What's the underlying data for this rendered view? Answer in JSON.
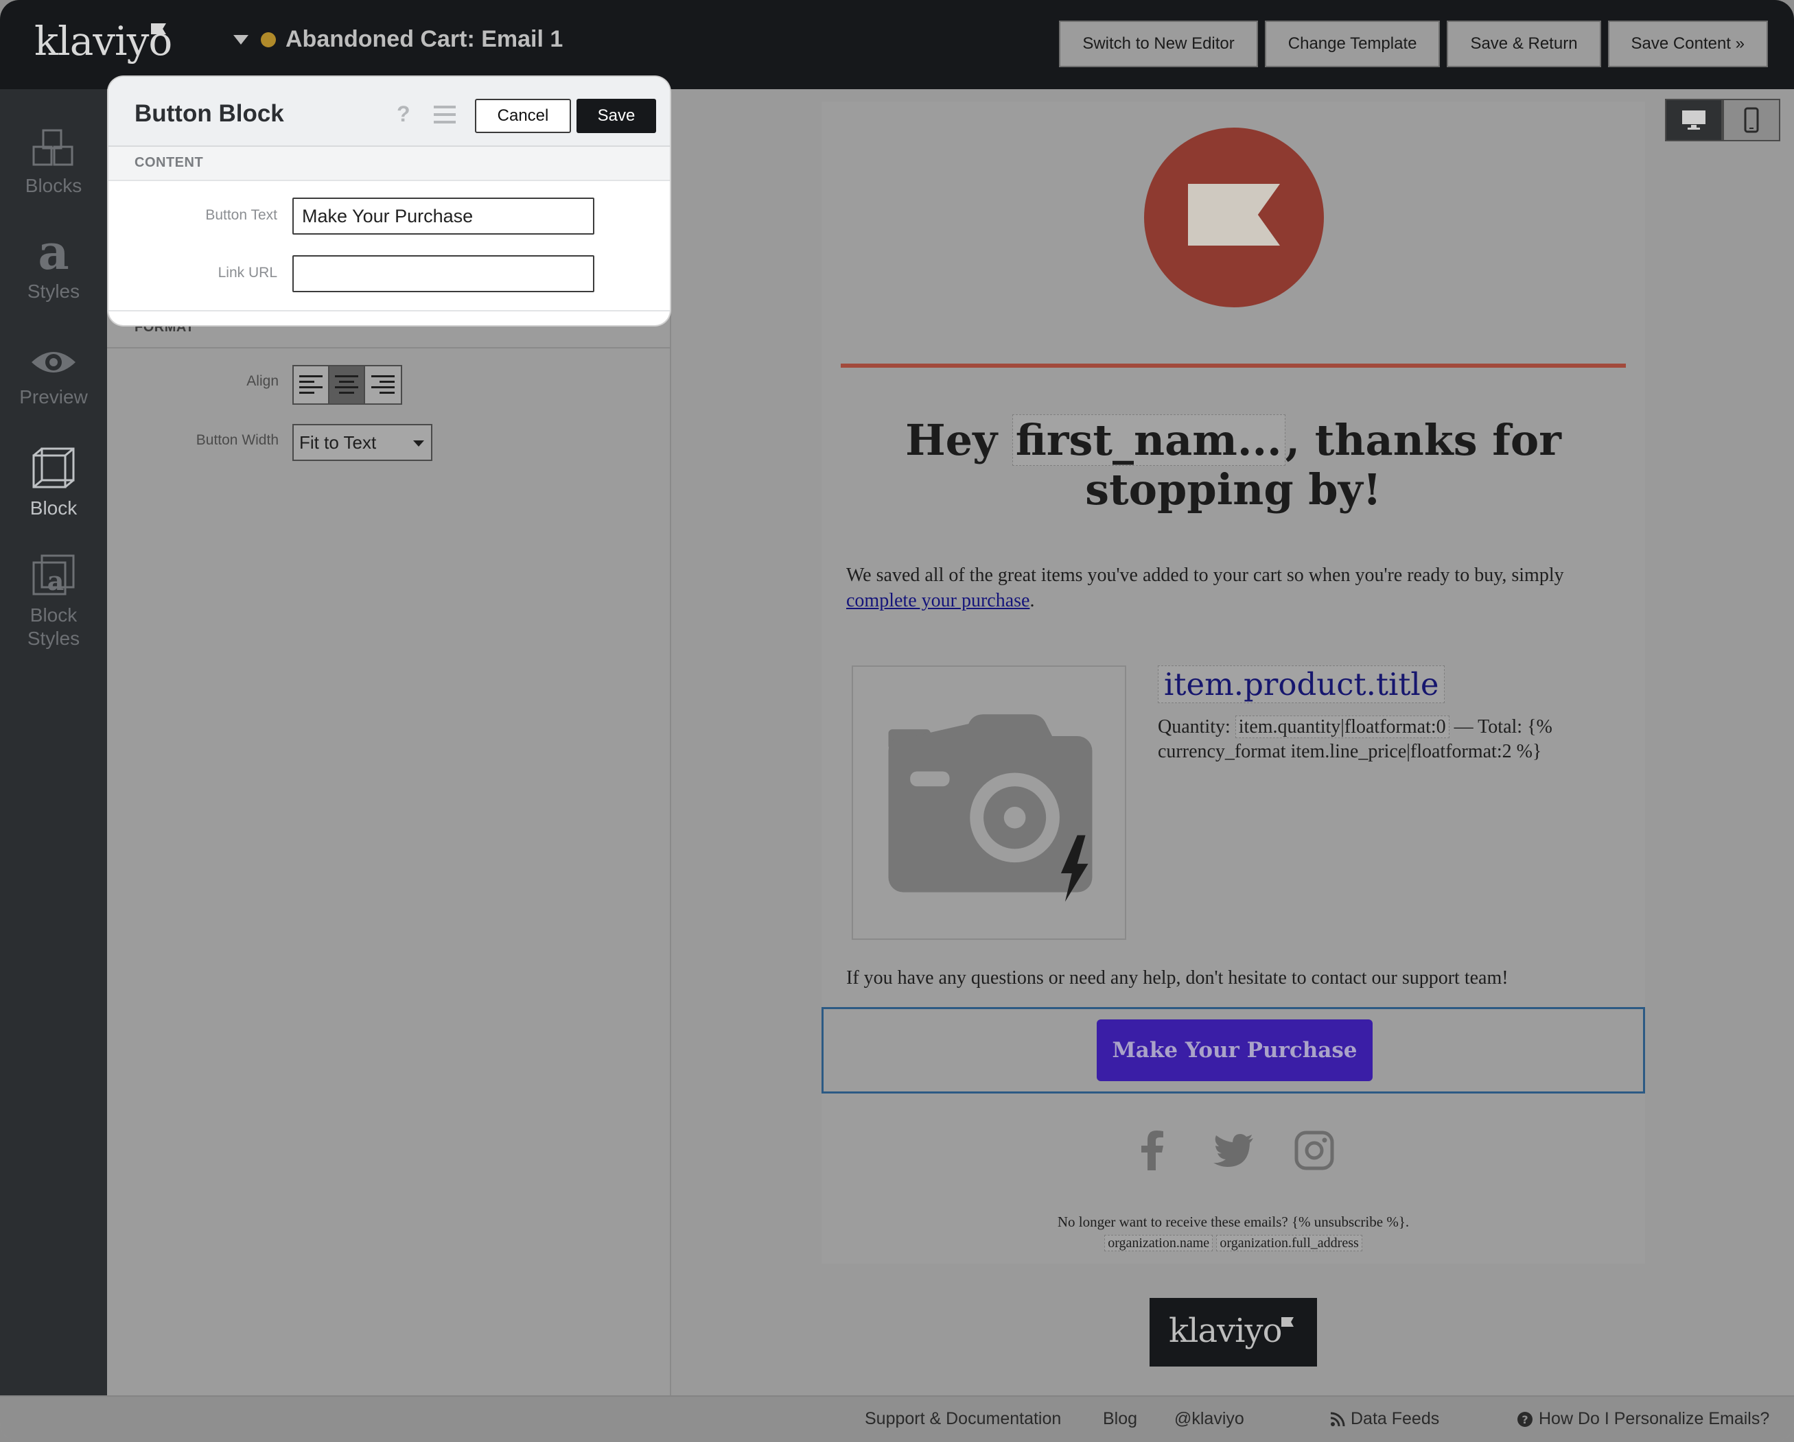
{
  "app": {
    "brand": "klaviyo",
    "email_title": "Abandoned Cart: Email 1",
    "top_buttons": {
      "switch_editor": "Switch to New Editor",
      "change_template": "Change Template",
      "save_return": "Save & Return",
      "save_content": "Save Content »"
    },
    "colors": {
      "status_dot": "#b08a2a",
      "cta": "#3a1ea6",
      "accent_line": "#a24a3c"
    }
  },
  "sidebar": {
    "items": [
      {
        "label": "Blocks",
        "icon": "blocks-icon"
      },
      {
        "label": "Styles",
        "icon": "styles-icon"
      },
      {
        "label": "Preview",
        "icon": "eye-icon"
      },
      {
        "label": "Block",
        "icon": "block-cube-icon"
      },
      {
        "label": "Block Styles",
        "icon": "block-styles-icon"
      }
    ],
    "active": "Block"
  },
  "panel": {
    "title": "Button Block",
    "cancel_label": "Cancel",
    "save_label": "Save",
    "content_section": "CONTENT",
    "format_section": "FORMAT",
    "button_text_label": "Button Text",
    "button_text_value": "Make Your Purchase",
    "link_url_label": "Link URL",
    "link_url_value": "",
    "align_label": "Align",
    "align_selected": "center",
    "button_width_label": "Button Width",
    "button_width_value": "Fit to Text"
  },
  "email": {
    "headline_pre": "Hey",
    "headline_merge": "first_nam...",
    "headline_post": ", thanks for stopping by!",
    "intro": "We saved all of the great items you've added to your cart so when you're ready to buy, simply",
    "intro_link": "complete your purchase",
    "intro_end": ".",
    "product_title": "item.product.title",
    "quantity_label": "Quantity:",
    "quantity_merge": "item.quantity|floatformat:0",
    "total_label": "— Total:",
    "total_expr": "{% currency_format item.line_price|floatformat:2 %}",
    "help_text": "If you have any questions or need any help, don't hesitate to contact our support team!",
    "cta_label": "Make Your Purchase",
    "unsubscribe": "No longer want to receive these emails? {% unsubscribe %}.",
    "org_name": "organization.name",
    "org_address": "organization.full_address",
    "footer_brand": "klaviyo"
  },
  "footer": {
    "support": "Support & Documentation",
    "blog": "Blog",
    "twitter": "@klaviyo",
    "data_feeds": "Data Feeds",
    "personalize": "How Do I Personalize Emails?"
  }
}
